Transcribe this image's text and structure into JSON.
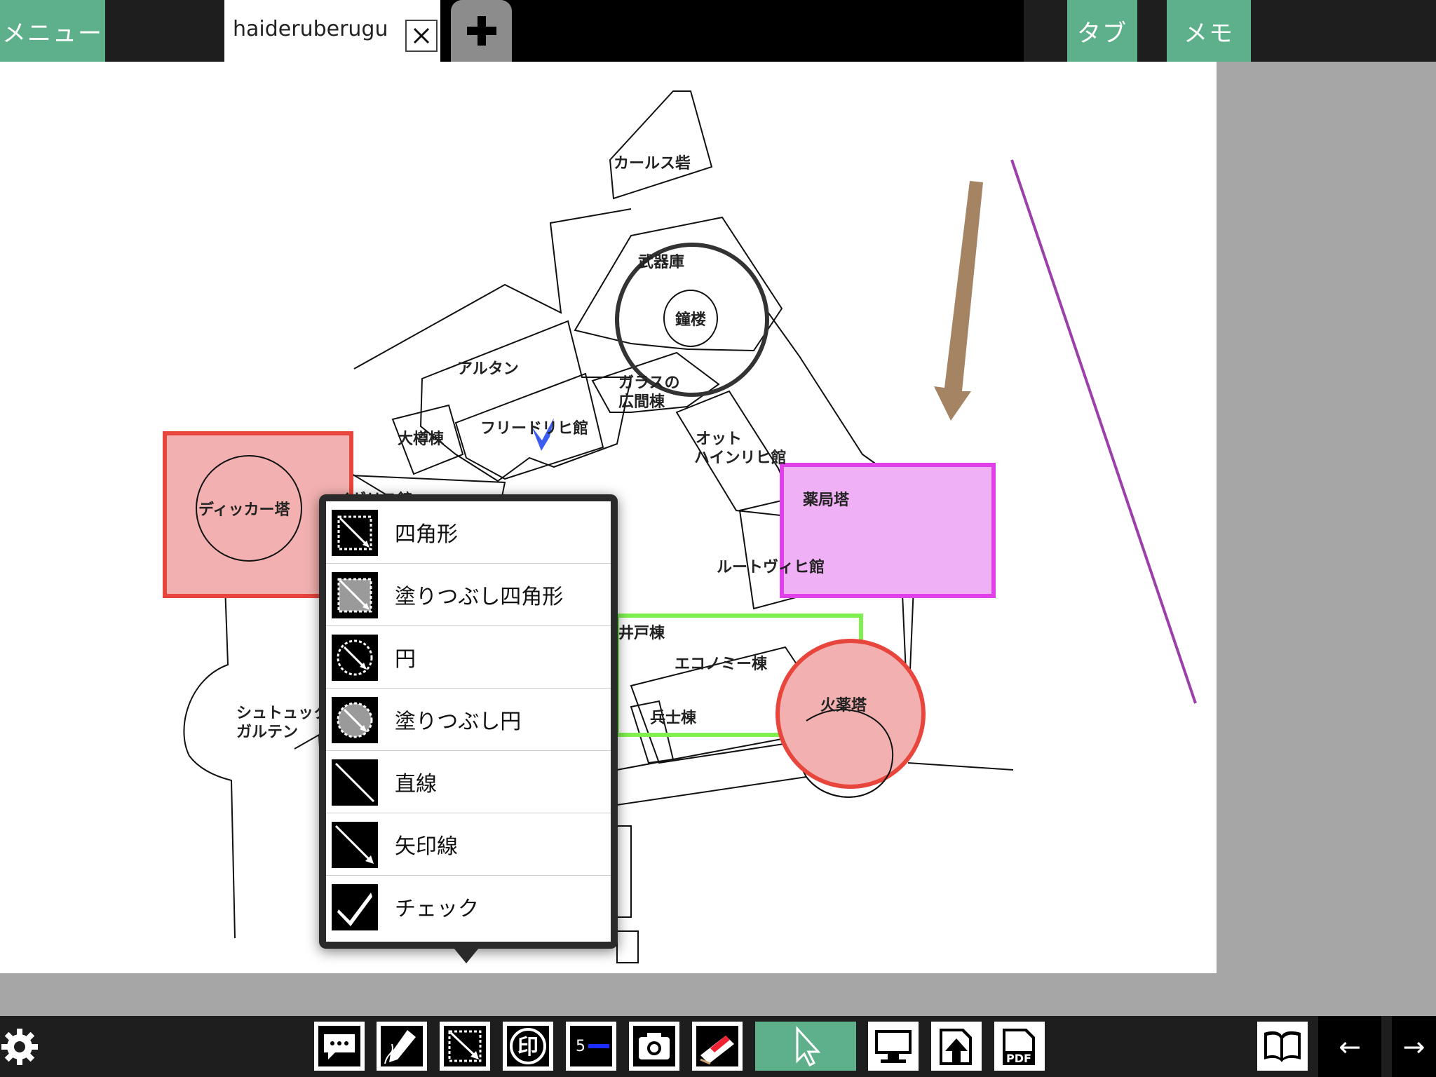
{
  "topbar": {
    "menu_label": "メニュー",
    "tab_title": "haideruberugu",
    "tab_close": "✕",
    "add_tab": "+",
    "tab_button": "タブ",
    "memo_button": "メモ"
  },
  "map": {
    "labels": {
      "karls": "カールス砦",
      "armory": "武器庫",
      "belltower": "鐘楼",
      "altan": "アルタン",
      "glass": "ガラスの",
      "glass2": "広間棟",
      "friedrich": "フリードリヒ館",
      "barrel": "大樽棟",
      "otto": "オット",
      "otto2": "ハインリヒ館",
      "dicker": "ディッカー塔",
      "english": "イギリス館",
      "apothecary": "薬局塔",
      "ludwig": "ルートヴィヒ館",
      "well": "井戸棟",
      "economy": "エコノミー棟",
      "soldier": "兵士棟",
      "powder": "火薬塔",
      "stuck": "シュトュック",
      "garten": "ガルテン"
    }
  },
  "shape_menu": {
    "items": [
      {
        "label": "四角形",
        "icon": "rectangle-outline-icon"
      },
      {
        "label": "塗りつぶし四角形",
        "icon": "rectangle-filled-icon"
      },
      {
        "label": "円",
        "icon": "circle-outline-icon"
      },
      {
        "label": "塗りつぶし円",
        "icon": "circle-filled-icon"
      },
      {
        "label": "直線",
        "icon": "line-icon"
      },
      {
        "label": "矢印線",
        "icon": "arrow-line-icon"
      },
      {
        "label": "チェック",
        "icon": "check-icon"
      }
    ]
  },
  "toolbar": {
    "pen_width": "5",
    "tools": [
      "settings-icon",
      "comment-icon",
      "pen-icon",
      "shape-icon",
      "stamp-icon",
      "line-width-icon",
      "camera-icon",
      "eraser-icon",
      "select-icon",
      "present-icon",
      "export-icon",
      "pdf-icon",
      "book-icon",
      "back-icon",
      "forward-icon"
    ],
    "stamp_char": "印",
    "pdf_text": "PDF",
    "back_label": "←",
    "forward_label": "→"
  },
  "colors": {
    "accent": "#5eb08a",
    "rect_red": "#e8453c",
    "rect_magenta": "#e040e8",
    "rect_green": "#80f050",
    "arrow_brown": "#a48463",
    "line_purple": "#9b40a8",
    "check_blue": "#3c5cf0"
  }
}
